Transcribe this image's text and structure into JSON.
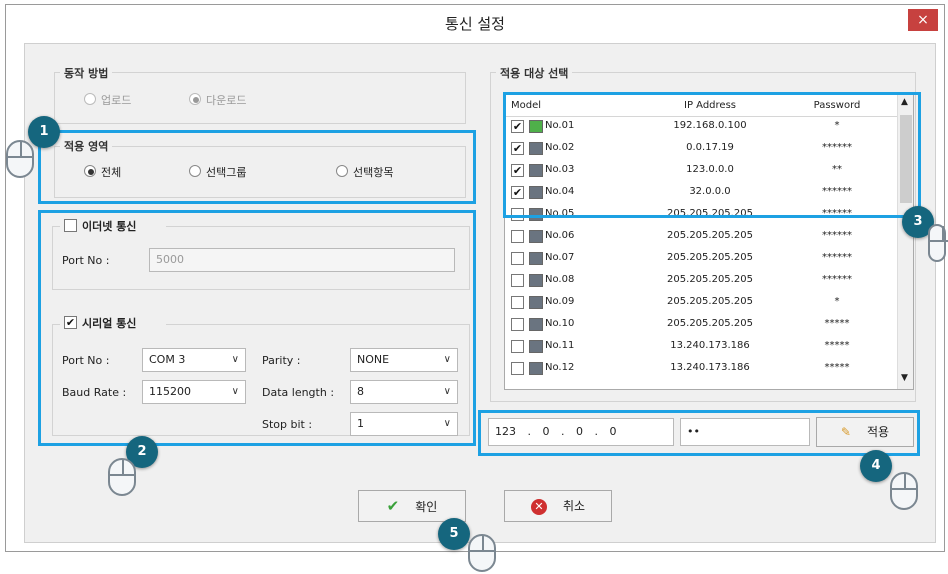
{
  "window": {
    "title": "통신 설정",
    "close_glyph": "×"
  },
  "operation": {
    "legend": "동작 방법",
    "options": [
      {
        "label": "업로드",
        "selected": false
      },
      {
        "label": "다운로드",
        "selected": true
      }
    ]
  },
  "scope": {
    "legend": "적용 영역",
    "options": [
      {
        "label": "전체",
        "selected": true
      },
      {
        "label": "선택그룹",
        "selected": false
      },
      {
        "label": "선택항목",
        "selected": false
      }
    ]
  },
  "ethernet": {
    "label": "이더넷 통신",
    "checked": false,
    "port_label": "Port No :",
    "port_value": "5000"
  },
  "serial": {
    "label": "시리얼 통신",
    "checked": true,
    "port_label": "Port No :",
    "port_value": "COM 3",
    "baud_label": "Baud Rate :",
    "baud_value": "115200",
    "parity_label": "Parity :",
    "parity_value": "NONE",
    "datalen_label": "Data length :",
    "datalen_value": "8",
    "stopbit_label": "Stop bit :",
    "stopbit_value": "1"
  },
  "target": {
    "legend": "적용 대상 선택",
    "columns": [
      "Model",
      "IP Address",
      "Password"
    ],
    "rows": [
      {
        "checked": true,
        "online": true,
        "name": "No.01",
        "ip": "192.168.0.100",
        "pw": "*"
      },
      {
        "checked": true,
        "online": false,
        "name": "No.02",
        "ip": "0.0.17.19",
        "pw": "******"
      },
      {
        "checked": true,
        "online": false,
        "name": "No.03",
        "ip": "123.0.0.0",
        "pw": "**"
      },
      {
        "checked": true,
        "online": false,
        "name": "No.04",
        "ip": "32.0.0.0",
        "pw": "******"
      },
      {
        "checked": false,
        "online": false,
        "name": "No.05",
        "ip": "205.205.205.205",
        "pw": "******"
      },
      {
        "checked": false,
        "online": false,
        "name": "No.06",
        "ip": "205.205.205.205",
        "pw": "******"
      },
      {
        "checked": false,
        "online": false,
        "name": "No.07",
        "ip": "205.205.205.205",
        "pw": "******"
      },
      {
        "checked": false,
        "online": false,
        "name": "No.08",
        "ip": "205.205.205.205",
        "pw": "******"
      },
      {
        "checked": false,
        "online": false,
        "name": "No.09",
        "ip": "205.205.205.205",
        "pw": "*"
      },
      {
        "checked": false,
        "online": false,
        "name": "No.10",
        "ip": "205.205.205.205",
        "pw": "*****"
      },
      {
        "checked": false,
        "online": false,
        "name": "No.11",
        "ip": "13.240.173.186",
        "pw": "*****"
      },
      {
        "checked": false,
        "online": false,
        "name": "No.12",
        "ip": "13.240.173.186",
        "pw": "*****"
      }
    ]
  },
  "apply_bar": {
    "ip_parts": [
      "123",
      "0",
      "0",
      "0"
    ],
    "ip_separator": ".",
    "password": "••",
    "apply_label": "적용"
  },
  "buttons": {
    "ok_label": "확인",
    "cancel_label": "취소"
  },
  "callouts": [
    "1",
    "2",
    "3",
    "4",
    "5"
  ],
  "colors": {
    "highlight": "#1da1e3",
    "badge": "#15667e",
    "close": "#c7413f"
  }
}
